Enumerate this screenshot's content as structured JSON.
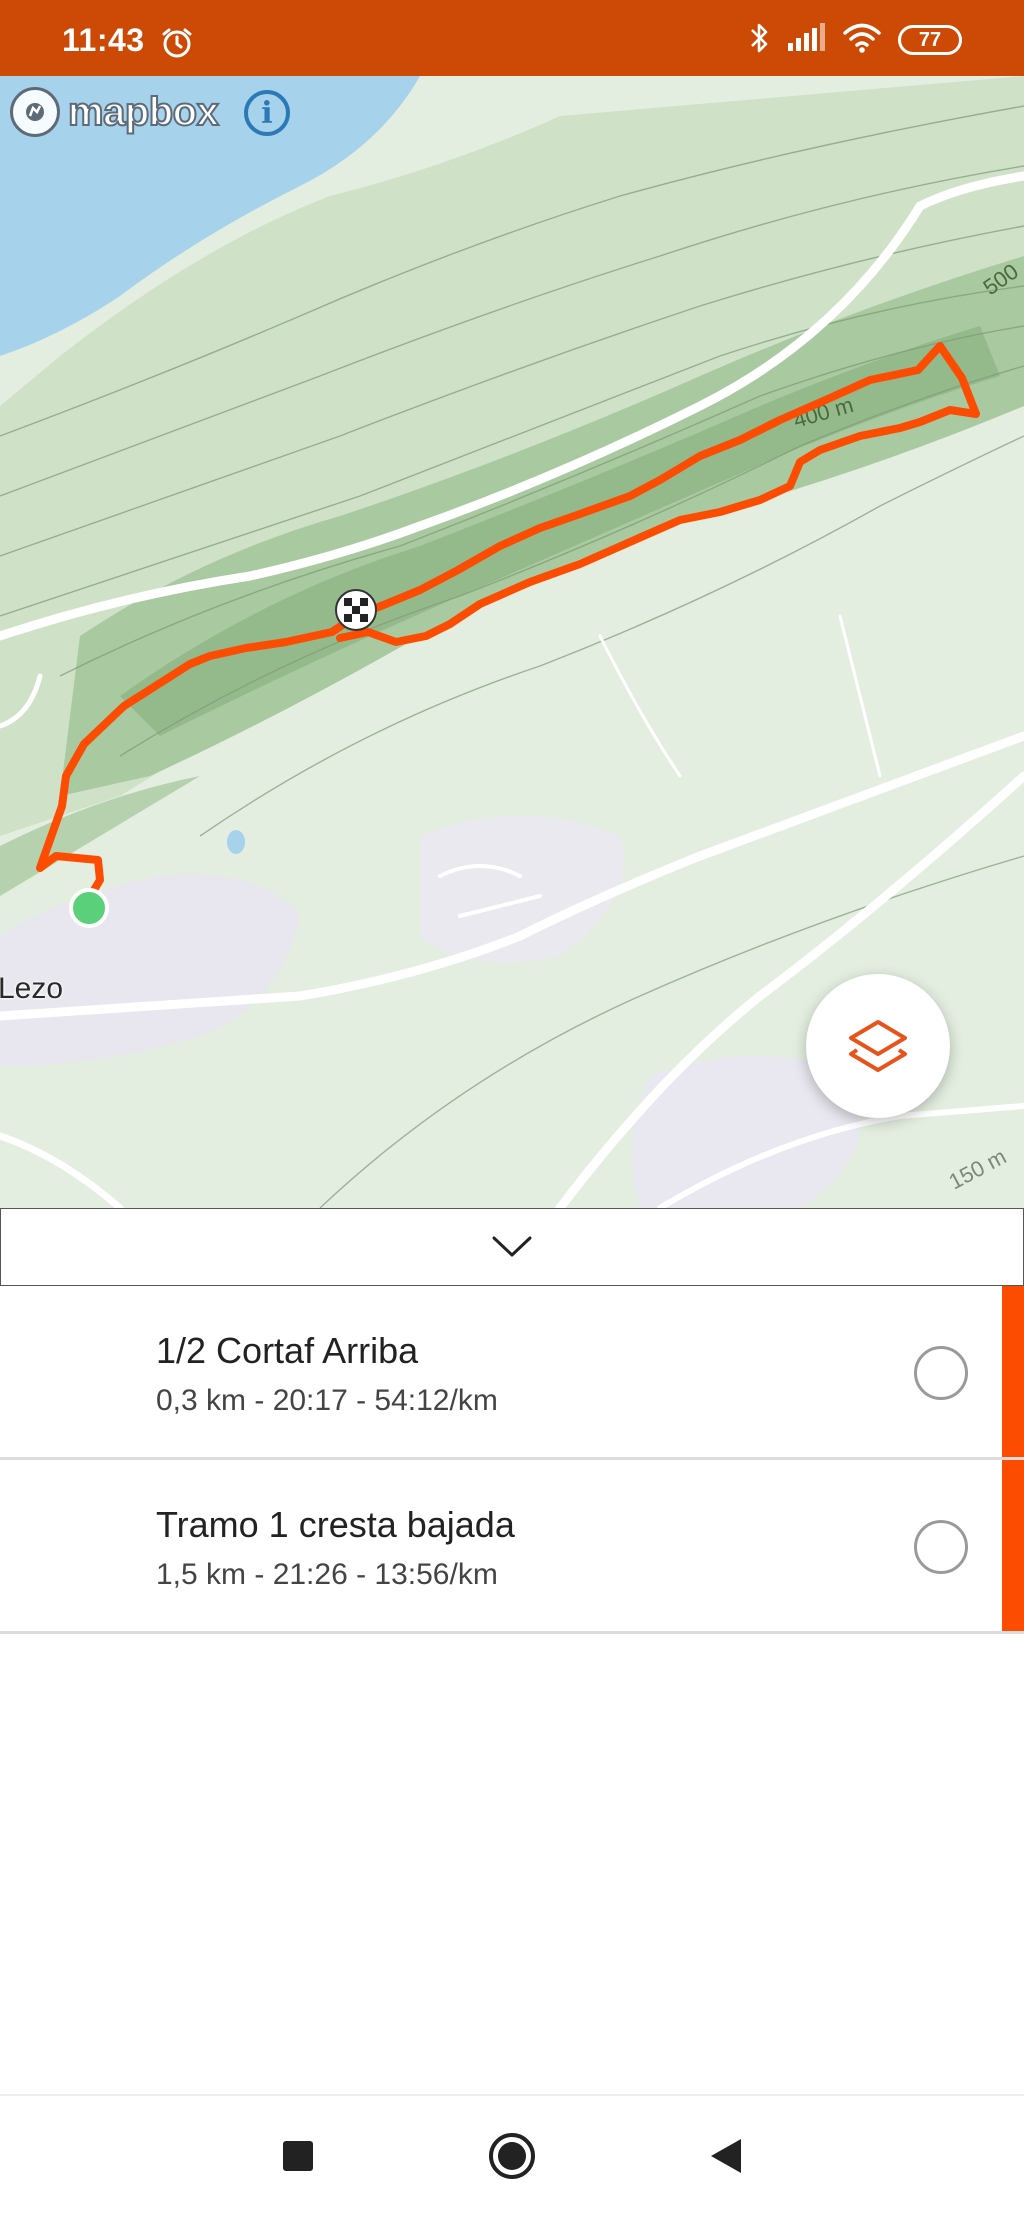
{
  "status_bar": {
    "time": "11:43",
    "battery": "77",
    "icons": [
      "alarm-icon",
      "bluetooth-icon",
      "signal-icon",
      "wifi-icon",
      "battery-icon"
    ]
  },
  "map": {
    "attribution": "mapbox",
    "info_symbol": "i",
    "place_label": "Lezo",
    "contour_labels": [
      "500",
      "400 m",
      "150 m"
    ],
    "route_color": "#fc4c02",
    "start_marker_color": "#5ad07a",
    "layers_icon_color": "#e8531a"
  },
  "segments": [
    {
      "name": "1/2 Cortaf Arriba",
      "stats": "0,3 km - 20:17 - 54:12/km",
      "accent": "#fc4c02"
    },
    {
      "name": "Tramo 1 cresta bajada",
      "stats": "1,5 km - 21:26 - 13:56/km",
      "accent": "#fc4c02"
    }
  ],
  "nav": {
    "icons": [
      "recents-square-icon",
      "home-circle-icon",
      "back-triangle-icon"
    ]
  },
  "colors": {
    "status_bar": "#cc4a06",
    "accent": "#fc4c02",
    "water": "#a6d2ec",
    "land": "#e3eee0"
  }
}
